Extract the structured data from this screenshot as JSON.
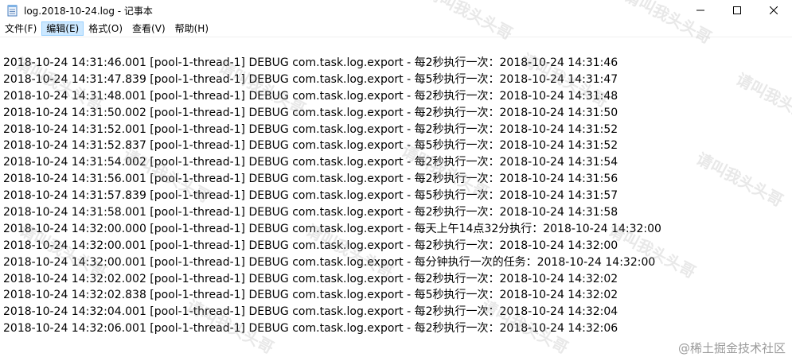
{
  "window": {
    "title": "log.2018-10-24.log - 记事本"
  },
  "menubar": {
    "items": [
      {
        "label": "文件(F)"
      },
      {
        "label": "编辑(E)"
      },
      {
        "label": "格式(O)"
      },
      {
        "label": "查看(V)"
      },
      {
        "label": "帮助(H)"
      }
    ],
    "active_index": 1
  },
  "editor": {
    "lines": [
      "2018-10-24 14:31:46.001 [pool-1-thread-1] DEBUG com.task.log.export - 每2秒执行一次：2018-10-24 14:31:46",
      "2018-10-24 14:31:47.839 [pool-1-thread-1] DEBUG com.task.log.export - 每5秒执行一次：2018-10-24 14:31:47",
      "2018-10-24 14:31:48.001 [pool-1-thread-1] DEBUG com.task.log.export - 每2秒执行一次：2018-10-24 14:31:48",
      "2018-10-24 14:31:50.002 [pool-1-thread-1] DEBUG com.task.log.export - 每2秒执行一次：2018-10-24 14:31:50",
      "2018-10-24 14:31:52.001 [pool-1-thread-1] DEBUG com.task.log.export - 每2秒执行一次：2018-10-24 14:31:52",
      "2018-10-24 14:31:52.837 [pool-1-thread-1] DEBUG com.task.log.export - 每5秒执行一次：2018-10-24 14:31:52",
      "2018-10-24 14:31:54.002 [pool-1-thread-1] DEBUG com.task.log.export - 每2秒执行一次：2018-10-24 14:31:54",
      "2018-10-24 14:31:56.001 [pool-1-thread-1] DEBUG com.task.log.export - 每2秒执行一次：2018-10-24 14:31:56",
      "2018-10-24 14:31:57.839 [pool-1-thread-1] DEBUG com.task.log.export - 每5秒执行一次：2018-10-24 14:31:57",
      "2018-10-24 14:31:58.001 [pool-1-thread-1] DEBUG com.task.log.export - 每2秒执行一次：2018-10-24 14:31:58",
      "2018-10-24 14:32:00.000 [pool-1-thread-1] DEBUG com.task.log.export - 每天上午14点32分执行：2018-10-24 14:32:00",
      "2018-10-24 14:32:00.001 [pool-1-thread-1] DEBUG com.task.log.export - 每2秒执行一次：2018-10-24 14:32:00",
      "2018-10-24 14:32:00.001 [pool-1-thread-1] DEBUG com.task.log.export - 每分钟执行一次的任务：2018-10-24 14:32:00",
      "2018-10-24 14:32:02.002 [pool-1-thread-1] DEBUG com.task.log.export - 每2秒执行一次：2018-10-24 14:32:02",
      "2018-10-24 14:32:02.838 [pool-1-thread-1] DEBUG com.task.log.export - 每5秒执行一次：2018-10-24 14:32:02",
      "2018-10-24 14:32:04.001 [pool-1-thread-1] DEBUG com.task.log.export - 每2秒执行一次：2018-10-24 14:32:04",
      "2018-10-24 14:32:06.001 [pool-1-thread-1] DEBUG com.task.log.export - 每2秒执行一次：2018-10-24 14:32:06"
    ]
  },
  "watermarks": {
    "text": "请叫我头头哥",
    "corner_text": "@稀土掘金技术社区"
  },
  "icons": {
    "app": "notepad-icon",
    "minimize": "minimize-icon",
    "maximize": "maximize-icon",
    "close": "close-icon"
  },
  "colors": {
    "menu_active_bg": "#cce8ff",
    "menu_active_border": "#99d1ff",
    "text": "#000000"
  }
}
